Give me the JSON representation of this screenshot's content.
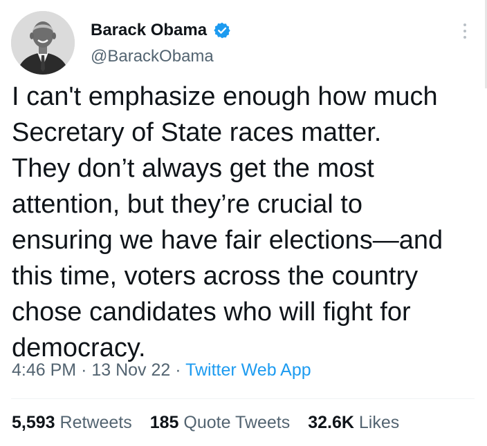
{
  "user": {
    "display_name": "Barack Obama",
    "handle": "@BarackObama",
    "verified_icon": "verified-badge-icon",
    "avatar": "profile-photo"
  },
  "tweet": {
    "text": "I can't emphasize enough how much\nSecretary of State races matter.\nThey don’t always get the most\nattention, but they’re crucial to\nensuring we have fair elections—and\nthis time, voters across the country\nchose candidates who will fight for\ndemocracy.",
    "time": "4:46 PM",
    "date": "13 Nov 22",
    "separator": "·",
    "source": "Twitter Web App"
  },
  "stats": {
    "retweets_count": "5,593",
    "retweets_label": "Retweets",
    "quotes_count": "185",
    "quotes_label": "Quote Tweets",
    "likes_count": "32.6K",
    "likes_label": "Likes"
  },
  "colors": {
    "text": "#0f1419",
    "secondary": "#536471",
    "accent": "#1d9bf0",
    "divider": "#eff3f4"
  },
  "icons": {
    "more": "more-vertical-icon"
  }
}
